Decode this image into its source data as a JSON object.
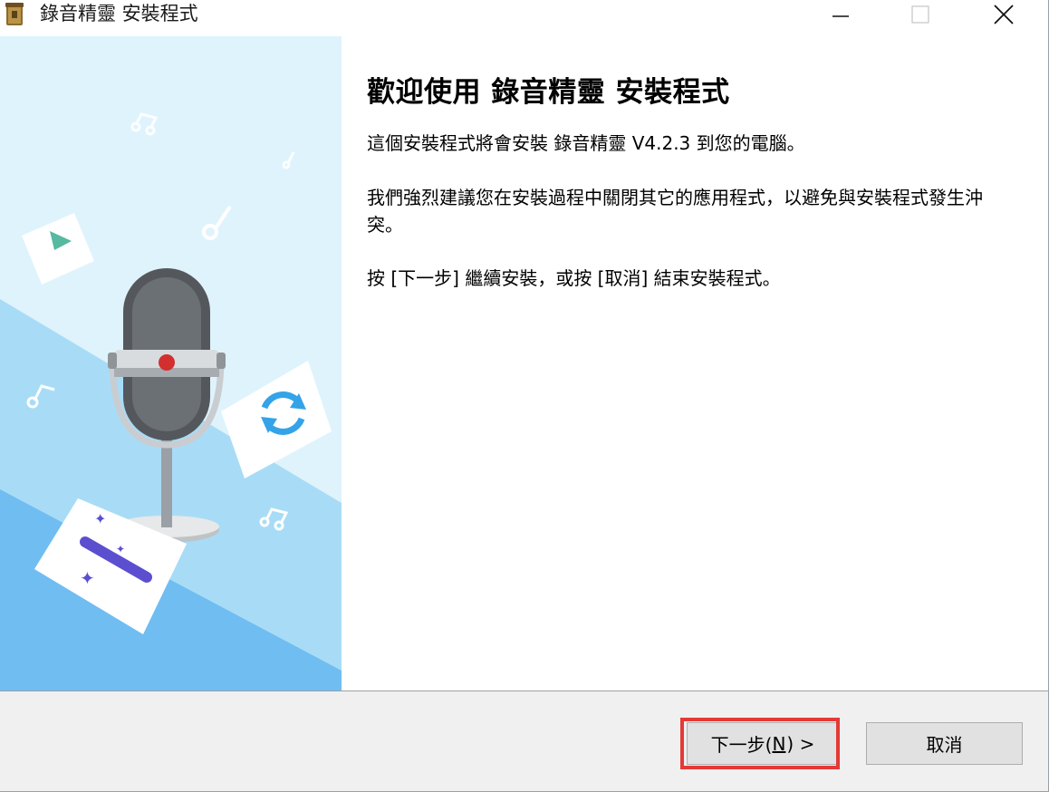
{
  "window": {
    "title": "錄音精靈 安裝程式",
    "controls": {
      "minimize": "—",
      "maximize": "☐",
      "close": "✕"
    }
  },
  "banner": {
    "icons": [
      "music-note-icon",
      "play-icon",
      "microphone-icon",
      "sync-icon",
      "magic-wand-icon"
    ],
    "colors": {
      "light": "#d9f1fb",
      "mid": "#a9dcf5",
      "dark": "#6cbcf0"
    }
  },
  "main": {
    "heading": "歡迎使用 錄音精靈 安裝程式",
    "paragraph1": "這個安裝程式將會安裝 錄音精靈 V4.2.3 到您的電腦。",
    "paragraph2": "我們強烈建議您在安裝過程中關閉其它的應用程式，以避免與安裝程式發生沖突。",
    "paragraph3": "按 [下一步] 繼續安裝，或按 [取消] 結束安裝程式。"
  },
  "footer": {
    "next_label_prefix": "下一步(",
    "next_label_accel": "N",
    "next_label_suffix": ") >",
    "cancel_label": "取消",
    "highlight_color": "#e53935"
  }
}
